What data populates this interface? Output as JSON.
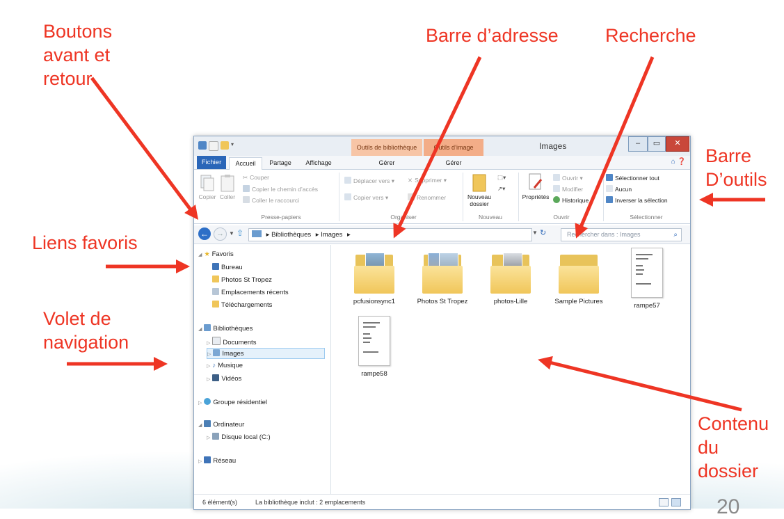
{
  "annotations": {
    "boutons": "Boutons\navant et\nretour",
    "barre_adresse": "Barre d’adresse",
    "recherche": "Recherche",
    "barre_outils": "Barre\nD’outils",
    "liens_favoris": "Liens favoris",
    "volet_navigation": "Volet de\nnavigation",
    "contenu": "Contenu\ndu\ndossier",
    "page_number": "20"
  },
  "colors": {
    "annotation": "#ee3524",
    "file_tab": "#2a66b8",
    "context_tab_1": "#f7c5a6",
    "context_tab_2": "#f3ad88",
    "close_button": "#c9473a"
  },
  "window": {
    "title": "Images",
    "context_tabs": [
      "Outils de bibliothèque",
      "Outils d’image"
    ],
    "controls": {
      "minimize": "–",
      "maximize": "▭",
      "close": "✕"
    }
  },
  "tabs": {
    "file": "Fichier",
    "home": "Accueil",
    "share": "Partage",
    "view": "Affichage",
    "manage1": "Gérer",
    "manage2": "Gérer",
    "help": "⌂ ❓"
  },
  "ribbon": {
    "clipboard": {
      "copy": "Copier",
      "paste": "Coller",
      "cut": "Couper",
      "copy_path": "Copier le chemin d’accès",
      "paste_shortcut": "Coller le raccourci",
      "label": "Presse-papiers"
    },
    "organize": {
      "move_to": "Déplacer vers ▾",
      "copy_to": "Copier vers ▾",
      "delete": "Supprimer ▾",
      "rename": "Renommer",
      "label": "Organiser"
    },
    "new": {
      "new_folder": "Nouveau dossier",
      "label": "Nouveau"
    },
    "open": {
      "properties": "Propriétés",
      "open": "Ouvrir ▾",
      "edit": "Modifier",
      "history": "Historique",
      "label": "Ouvrir"
    },
    "select": {
      "select_all": "Sélectionner tout",
      "none": "Aucun",
      "invert": "Inverser la sélection",
      "label": "Sélectionner"
    }
  },
  "address": {
    "crumbs": [
      "Bibliothèques",
      "Images"
    ],
    "search_placeholder": "Rechercher dans : Images"
  },
  "nav": {
    "favorites": "Favoris",
    "bureau": "Bureau",
    "photos_st_tropez": "Photos St Tropez",
    "recent": "Emplacements récents",
    "downloads": "Téléchargements",
    "libraries": "Bibliothèques",
    "documents": "Documents",
    "images": "Images",
    "music": "Musique",
    "videos": "Vidéos",
    "homegroup": "Groupe résidentiel",
    "computer": "Ordinateur",
    "local_disk": "Disque local (C:)",
    "network": "Réseau"
  },
  "files": [
    "pcfusionsync1",
    "Photos St Tropez",
    "photos-Lille",
    "Sample Pictures",
    "rampe57",
    "rampe58"
  ],
  "status": {
    "count": "6 élément(s)",
    "library_info": "La bibliothèque inclut : 2 emplacements"
  }
}
